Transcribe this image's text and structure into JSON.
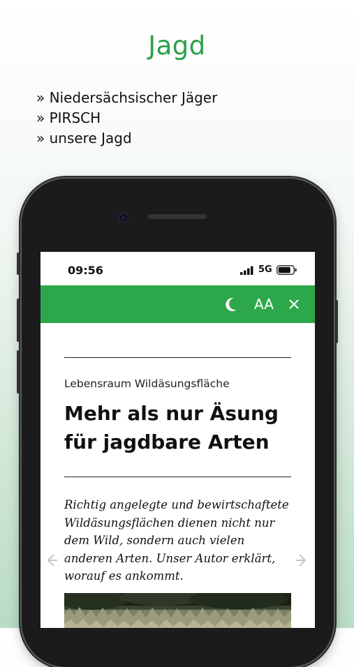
{
  "page": {
    "title": "Jagd",
    "features": [
      "» Niedersächsischer Jäger",
      "» PIRSCH",
      "» unsere Jagd"
    ]
  },
  "status_bar": {
    "time": "09:56",
    "network": "5G",
    "signal_icon": "cellular-signal-icon",
    "battery_icon": "battery-icon"
  },
  "toolbar": {
    "background_color": "#2ca84a",
    "night_mode_icon": "moon-icon",
    "font_size_label": "AA",
    "close_icon": "close-icon"
  },
  "article": {
    "kicker": "Lebensraum Wildäsungsfläche",
    "headline": "Mehr als nur Äsung für jagdbare Arten",
    "intro": "Richtig angelegte und bewirtschaftete Wildäsungsflächen dienen nicht nur dem Wild, sondern auch vielen anderen Arten. Unser Autor erklärt, worauf es ankommt."
  },
  "navigation": {
    "prev_icon": "chevron-left-icon",
    "next_icon": "chevron-right-icon"
  },
  "colors": {
    "accent": "#2ca84a",
    "title": "#2ba148"
  }
}
